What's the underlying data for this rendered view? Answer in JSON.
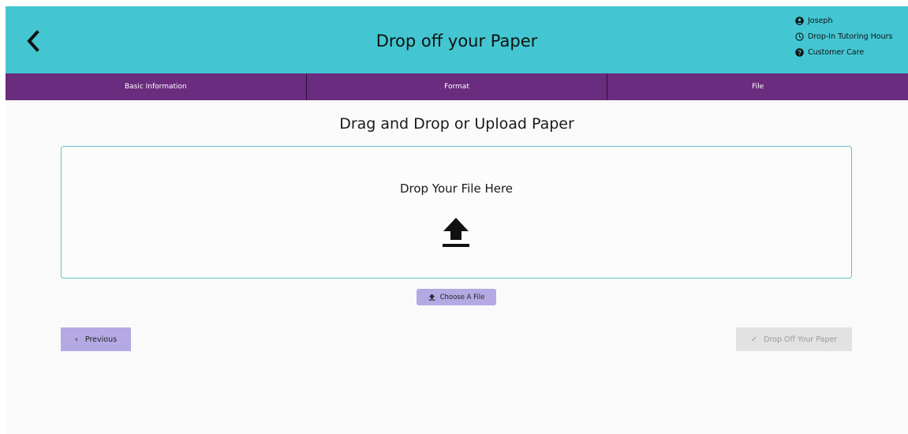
{
  "header": {
    "title": "Drop off your Paper",
    "back_icon": "chevron-left-icon",
    "background_color": "#43c6d2",
    "user_menu": [
      {
        "label": "Joseph",
        "icon": "user-circle-icon"
      },
      {
        "label": "Drop-In Tutoring Hours",
        "icon": "clock-icon"
      },
      {
        "label": "Customer Care",
        "icon": "question-circle-icon"
      }
    ]
  },
  "tabs": {
    "background_color": "#6a2c7e",
    "items": [
      {
        "label": "Basic Information"
      },
      {
        "label": "Format"
      },
      {
        "label": "File"
      }
    ]
  },
  "main": {
    "section_title": "Drag and Drop or Upload Paper",
    "dropzone": {
      "text": "Drop Your File Here",
      "icon": "upload-icon",
      "border_color": "#66bfc9"
    },
    "choose_file": {
      "label": "Choose A File",
      "icon": "upload-icon"
    },
    "previous": {
      "label": "Previous",
      "icon": "chevron-left-icon"
    },
    "drop_off": {
      "label": "Drop Off Your Paper",
      "icon": "check-icon",
      "disabled": true
    },
    "button_color": "#b4a9e3"
  }
}
